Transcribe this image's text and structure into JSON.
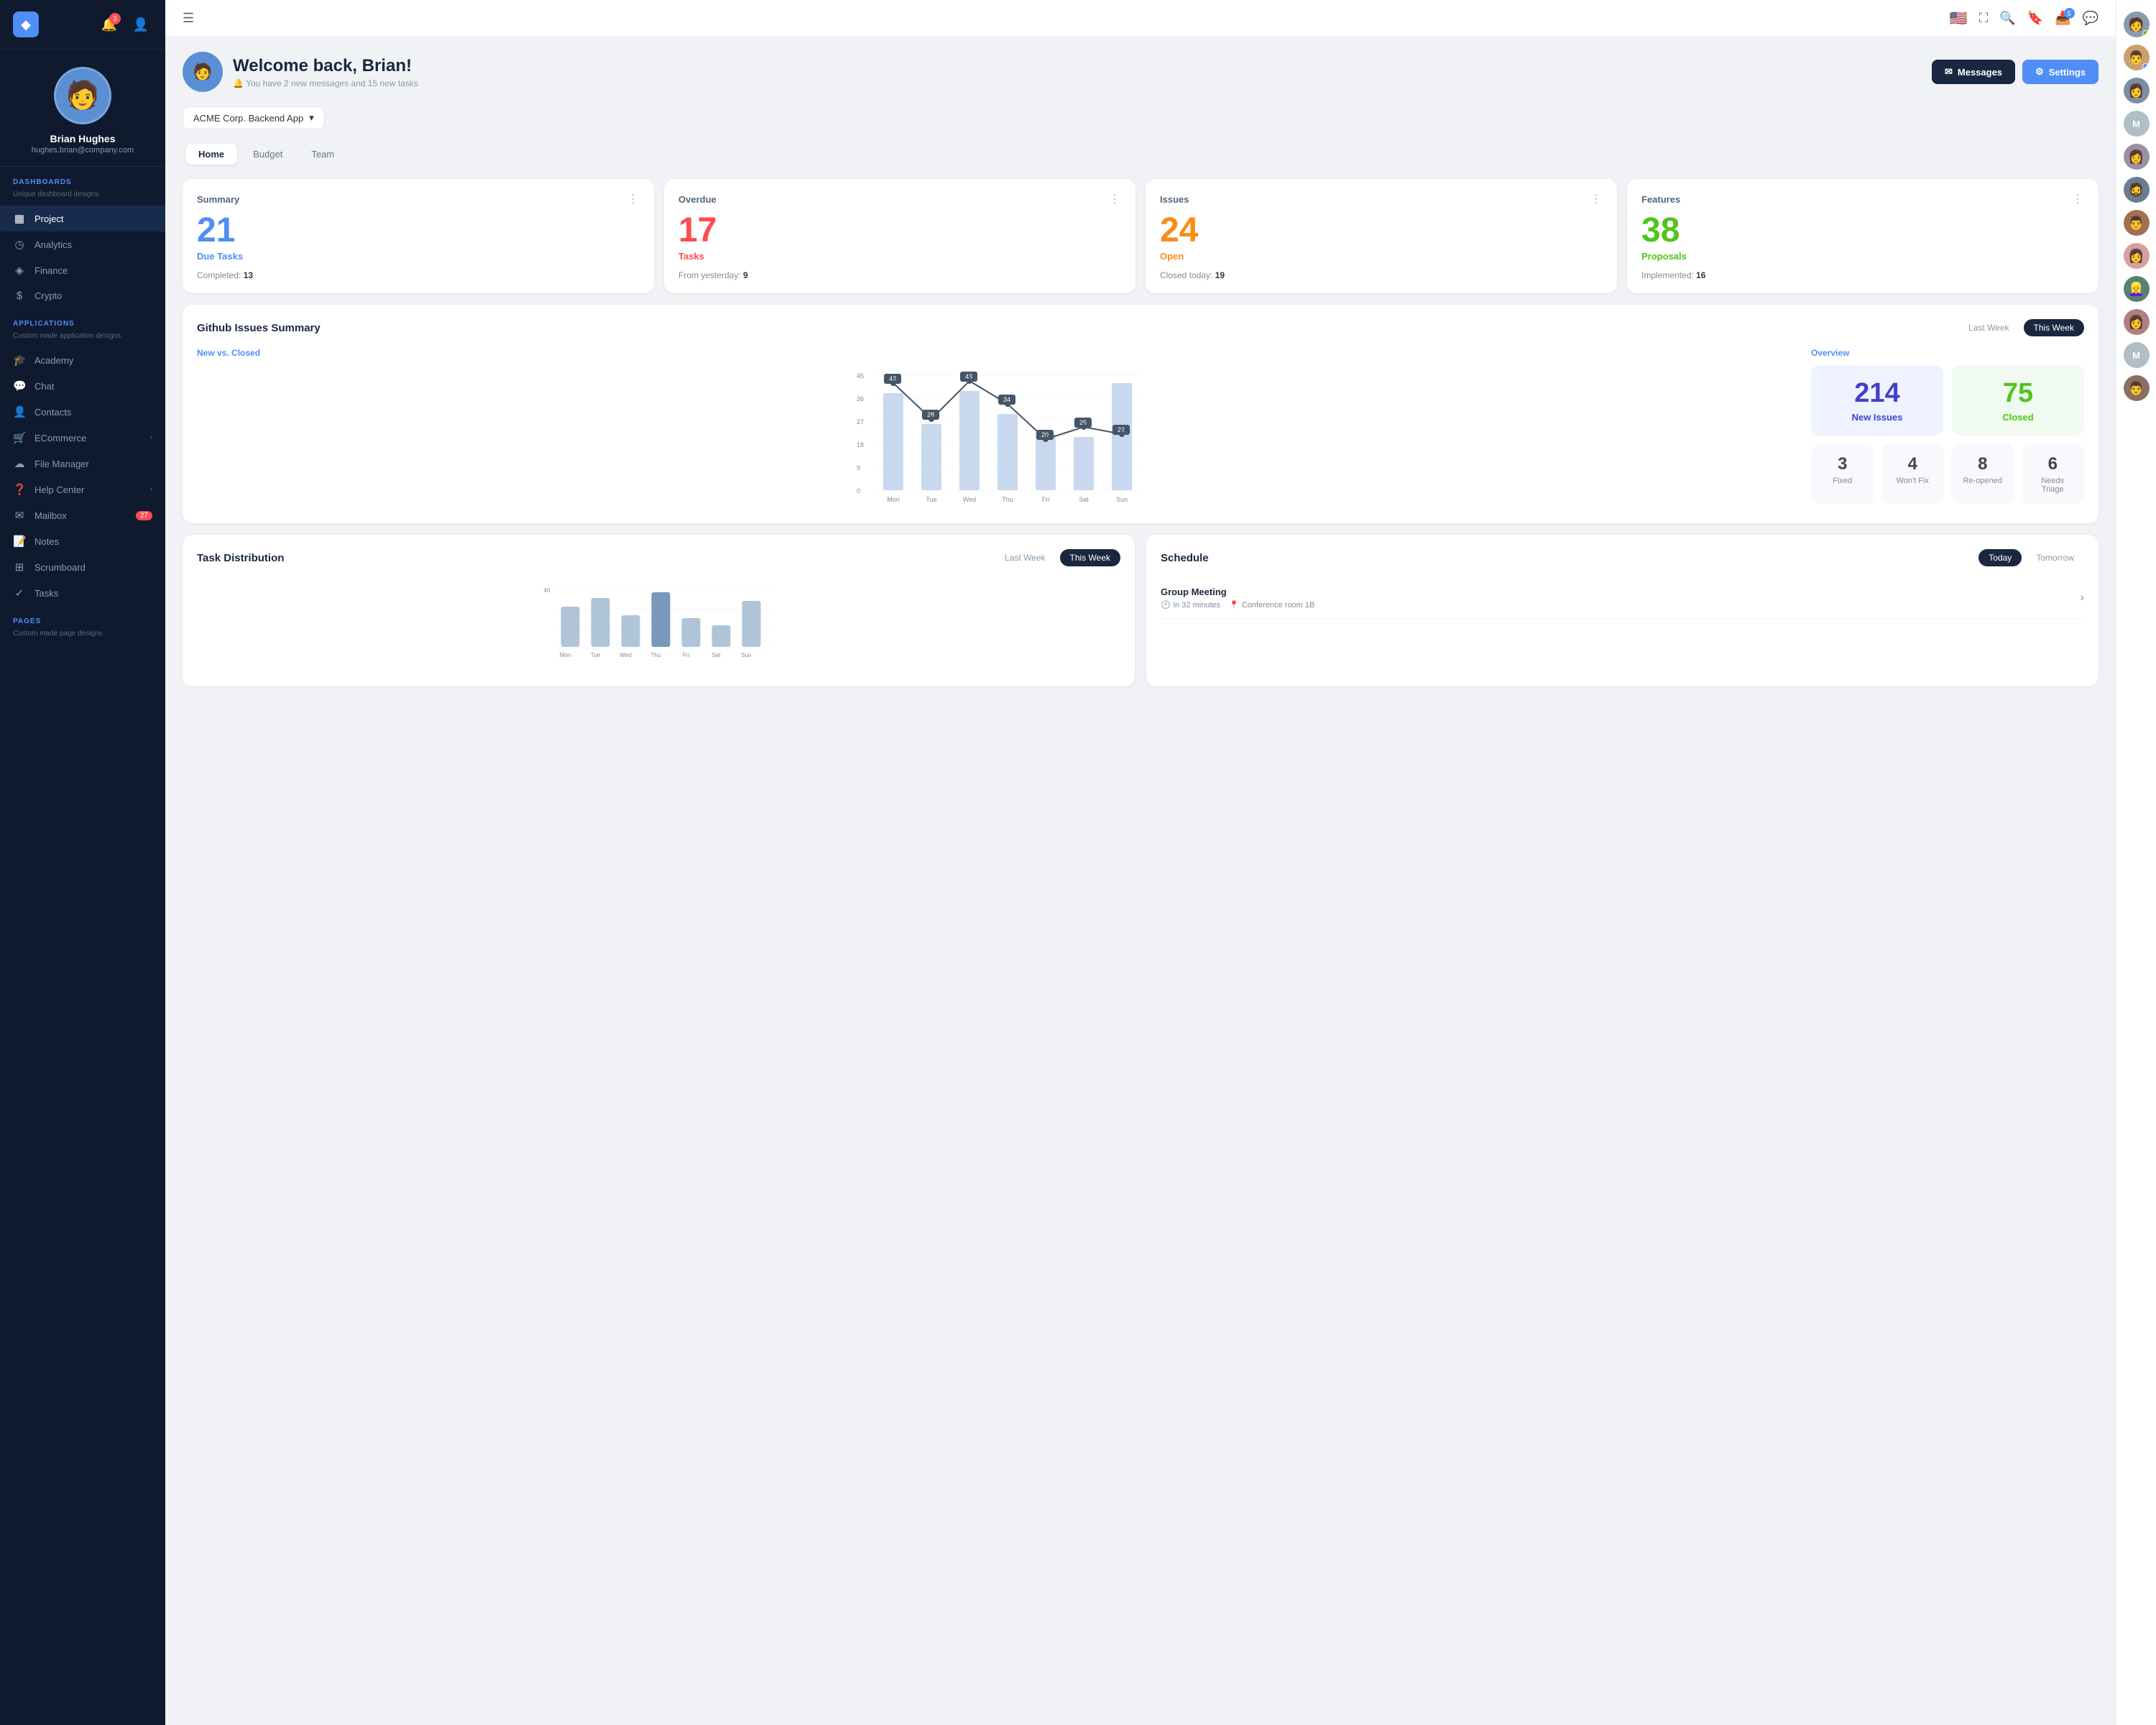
{
  "sidebar": {
    "logo_icon": "◆",
    "notif_count": "3",
    "profile": {
      "name": "Brian Hughes",
      "email": "hughes.brian@company.com"
    },
    "dashboards_label": "DASHBOARDS",
    "dashboards_sub": "Unique dashboard designs",
    "nav_items_dashboards": [
      {
        "id": "project",
        "icon": "▦",
        "label": "Project",
        "active": true
      },
      {
        "id": "analytics",
        "icon": "◷",
        "label": "Analytics",
        "active": false
      },
      {
        "id": "finance",
        "icon": "◈",
        "label": "Finance",
        "active": false
      },
      {
        "id": "crypto",
        "icon": "$",
        "label": "Crypto",
        "active": false
      }
    ],
    "applications_label": "APPLICATIONS",
    "applications_sub": "Custom made application designs",
    "nav_items_apps": [
      {
        "id": "academy",
        "icon": "🎓",
        "label": "Academy",
        "badge": null
      },
      {
        "id": "chat",
        "icon": "💬",
        "label": "Chat",
        "badge": null
      },
      {
        "id": "contacts",
        "icon": "👤",
        "label": "Contacts",
        "badge": null
      },
      {
        "id": "ecommerce",
        "icon": "🛒",
        "label": "ECommerce",
        "chevron": true
      },
      {
        "id": "filemanager",
        "icon": "☁",
        "label": "File Manager",
        "badge": null
      },
      {
        "id": "helpcenter",
        "icon": "❓",
        "label": "Help Center",
        "chevron": true
      },
      {
        "id": "mailbox",
        "icon": "✉",
        "label": "Mailbox",
        "badge": "27"
      },
      {
        "id": "notes",
        "icon": "📝",
        "label": "Notes",
        "badge": null
      },
      {
        "id": "scrumboard",
        "icon": "⊞",
        "label": "Scrumboard",
        "badge": null
      },
      {
        "id": "tasks",
        "icon": "✓",
        "label": "Tasks",
        "badge": null
      }
    ],
    "pages_label": "PAGES",
    "pages_sub": "Custom made page designs"
  },
  "topbar": {
    "menu_icon": "☰",
    "flag": "🇺🇸",
    "inbox_badge": "5"
  },
  "welcome": {
    "title": "Welcome back, Brian!",
    "subtitle": "You have 2 new messages and 15 new tasks",
    "messages_btn": "Messages",
    "settings_btn": "Settings"
  },
  "app_selector": {
    "label": "ACME Corp. Backend App",
    "chevron": "▾"
  },
  "tabs": [
    {
      "id": "home",
      "label": "Home",
      "active": true
    },
    {
      "id": "budget",
      "label": "Budget",
      "active": false
    },
    {
      "id": "team",
      "label": "Team",
      "active": false
    }
  ],
  "summary_cards": [
    {
      "id": "summary",
      "title": "Summary",
      "number": "21",
      "number_color": "blue",
      "label": "Due Tasks",
      "stat_key": "Completed:",
      "stat_val": "13"
    },
    {
      "id": "overdue",
      "title": "Overdue",
      "number": "17",
      "number_color": "red",
      "label": "Tasks",
      "stat_key": "From yesterday:",
      "stat_val": "9"
    },
    {
      "id": "issues",
      "title": "Issues",
      "number": "24",
      "number_color": "orange",
      "label": "Open",
      "stat_key": "Closed today:",
      "stat_val": "19"
    },
    {
      "id": "features",
      "title": "Features",
      "number": "38",
      "number_color": "green",
      "label": "Proposals",
      "stat_key": "Implemented:",
      "stat_val": "16"
    }
  ],
  "github": {
    "title": "Github Issues Summary",
    "last_week_btn": "Last Week",
    "this_week_btn": "This Week",
    "chart_subtitle": "New vs. Closed",
    "overview_subtitle": "Overview",
    "chart_data": {
      "days": [
        "Mon",
        "Tue",
        "Wed",
        "Thu",
        "Fri",
        "Sat",
        "Sun"
      ],
      "line_values": [
        42,
        28,
        43,
        34,
        20,
        25,
        22
      ],
      "bar_values": [
        38,
        26,
        39,
        30,
        22,
        21,
        42
      ]
    },
    "new_issues": "214",
    "new_issues_label": "New Issues",
    "closed": "75",
    "closed_label": "Closed",
    "stats": [
      {
        "num": "3",
        "label": "Fixed"
      },
      {
        "num": "4",
        "label": "Won't Fix"
      },
      {
        "num": "8",
        "label": "Re-opened"
      },
      {
        "num": "6",
        "label": "Needs Triage"
      }
    ]
  },
  "task_distribution": {
    "title": "Task Distribution",
    "last_week_btn": "Last Week",
    "this_week_btn": "This Week",
    "y_max": 40,
    "bars": [
      {
        "day": "Mon",
        "val": 28
      },
      {
        "day": "Tue",
        "val": 34
      },
      {
        "day": "Wed",
        "val": 22
      },
      {
        "day": "Thu",
        "val": 38
      },
      {
        "day": "Fri",
        "val": 20
      },
      {
        "day": "Sat",
        "val": 15
      },
      {
        "day": "Sun",
        "val": 32
      }
    ]
  },
  "schedule": {
    "title": "Schedule",
    "today_btn": "Today",
    "tomorrow_btn": "Tomorrow",
    "items": [
      {
        "id": "meeting-1",
        "title": "Group Meeting",
        "time": "in 32 minutes",
        "room": "Conference room 1B"
      }
    ]
  },
  "avatar_rail": [
    {
      "id": "a1",
      "initials": "",
      "color": "#8a9bb0",
      "dot": "online"
    },
    {
      "id": "a2",
      "initials": "",
      "color": "#c2a87a",
      "dot": "blue"
    },
    {
      "id": "a3",
      "initials": "",
      "color": "#7b8fa3",
      "dot": null
    },
    {
      "id": "a4",
      "initials": "M",
      "color": "#b0bec5",
      "dot": null
    },
    {
      "id": "a5",
      "initials": "",
      "color": "#9b8ea5",
      "dot": null
    },
    {
      "id": "a6",
      "initials": "",
      "color": "#6a7d8e",
      "dot": null
    },
    {
      "id": "a7",
      "initials": "",
      "color": "#a07050",
      "dot": null
    },
    {
      "id": "a8",
      "initials": "",
      "color": "#c9a0a0",
      "dot": null
    },
    {
      "id": "a9",
      "initials": "",
      "color": "#5a8070",
      "dot": null
    },
    {
      "id": "a10",
      "initials": "",
      "color": "#b08080",
      "dot": null
    },
    {
      "id": "a11",
      "initials": "M",
      "color": "#b0bec5",
      "dot": null
    },
    {
      "id": "a12",
      "initials": "",
      "color": "#8a7060",
      "dot": null
    }
  ]
}
